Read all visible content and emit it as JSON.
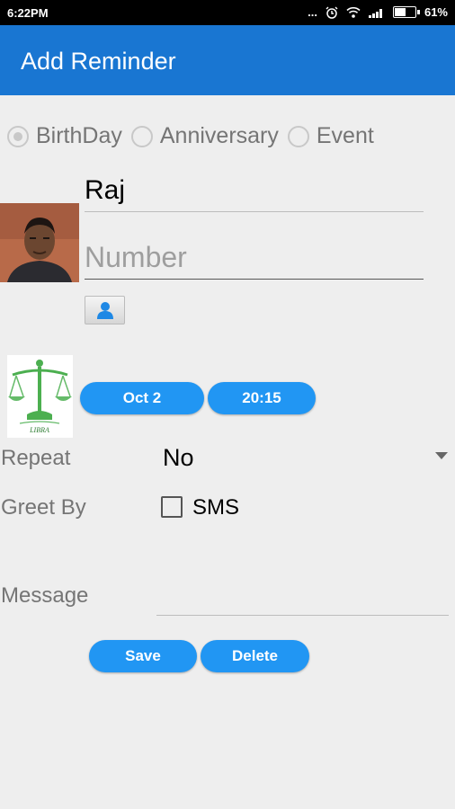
{
  "status_bar": {
    "time": "6:22PM",
    "dots": "...",
    "battery": "61%",
    "battery_level": 0.61,
    "icons": [
      "alarm-icon",
      "wifi-icon",
      "signal-icon",
      "battery-icon"
    ]
  },
  "app_bar": {
    "title": "Add Reminder",
    "color": "#1976d2"
  },
  "reminder_type": {
    "options": [
      "BirthDay",
      "Anniversary",
      "Event"
    ],
    "selected": "BirthDay"
  },
  "contact": {
    "name": "Raj",
    "number_placeholder": "Number",
    "picker_icon": "person-icon"
  },
  "zodiac": {
    "sign": "LIBRA"
  },
  "date_button": "Oct 2",
  "time_button": "20:15",
  "repeat": {
    "label": "Repeat",
    "value": "No"
  },
  "greet_by": {
    "label": "Greet By",
    "option": "SMS",
    "checked": false
  },
  "message": {
    "label": "Message",
    "value": ""
  },
  "actions": {
    "save": "Save",
    "delete": "Delete"
  },
  "colors": {
    "accent": "#2196f3",
    "background": "#eeeeee"
  }
}
